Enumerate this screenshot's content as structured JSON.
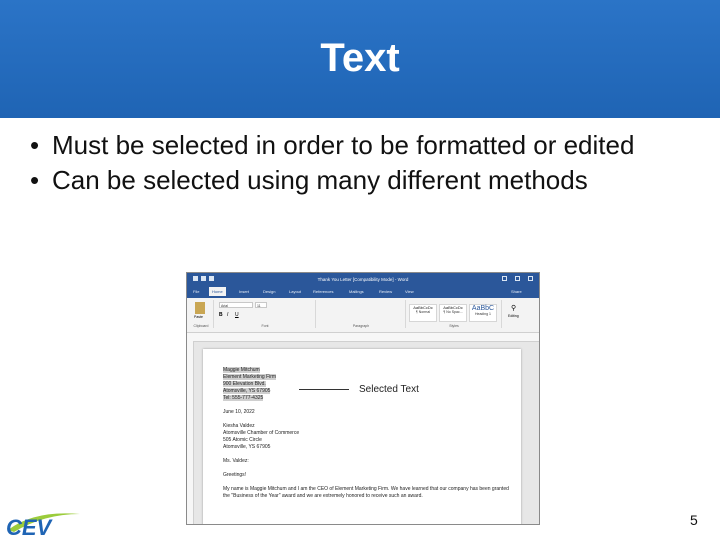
{
  "slide": {
    "title": "Text",
    "bullets": [
      "Must be selected in order to be formatted or edited",
      "Can be selected using many different methods"
    ],
    "page_number": "5",
    "logo_text": "CEV"
  },
  "screenshot": {
    "window_title": "Thank You Letter [Compatibility Mode] - Word",
    "tabs": [
      "File",
      "Home",
      "Insert",
      "Design",
      "Layout",
      "References",
      "Mailings",
      "Review",
      "View"
    ],
    "share": "Share",
    "font_name": "Arial",
    "font_size": "11",
    "groups": [
      "Clipboard",
      "Font",
      "Paragraph",
      "Styles",
      "Editing"
    ],
    "paste_label": "Paste",
    "styles": [
      "AaBbCcDc",
      "AaBbCcDc",
      "AaBbC"
    ],
    "style_names": [
      "¶ Normal",
      "¶ No Spac...",
      "Heading 1"
    ],
    "editing_label": "Editing",
    "callout": "Selected Text",
    "selected_lines": [
      "Maggie Mitchum",
      "Element Marketing Firm",
      "900 Elevation Blvd.",
      "Atomsville, YS 67905",
      "Tel: 555-777-4325"
    ],
    "date": "June 10, 2022",
    "recipient": [
      "Kiesha Valdez",
      "Atomsville Chamber of Commerce",
      "505 Atomic Circle",
      "Atomsville, YS 67905"
    ],
    "salutation": "Ms. Valdez:",
    "greeting": "Greetings!",
    "body": "My name is Maggie Mitchum and I am the CEO of Element Marketing Firm. We have learned that our company has been granted the \"Business of the Year\" award and we are extremely honored to receive such an award."
  },
  "colors": {
    "header_blue": "#2272c8",
    "word_blue": "#2b579a"
  }
}
